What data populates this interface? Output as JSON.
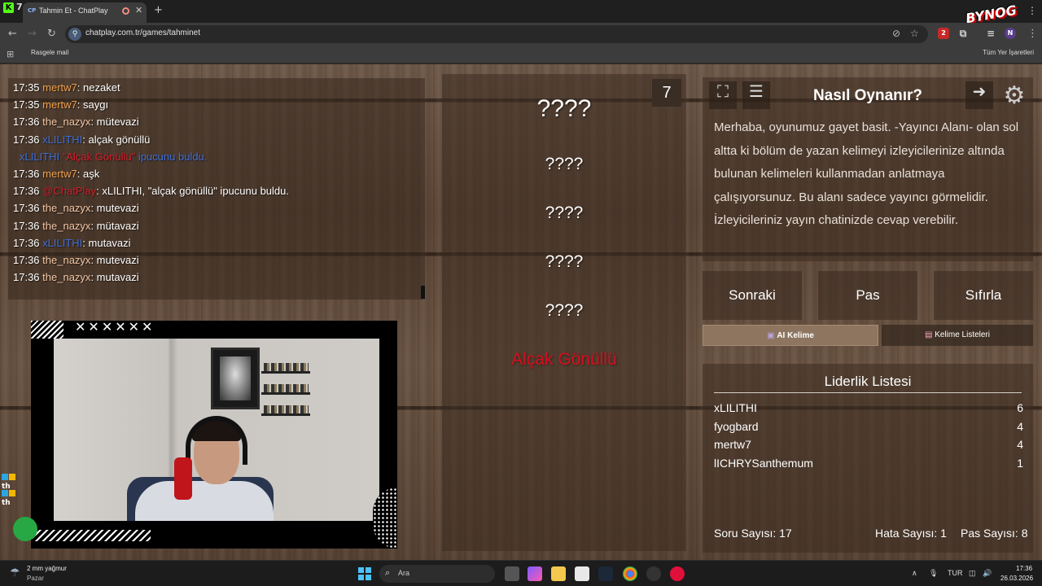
{
  "browser": {
    "k_badge": "K",
    "k_count": "7",
    "tab": {
      "favicon": "CP",
      "title": "Tahmin Et - ChatPlay"
    },
    "url": "chatplay.com.tr/games/tahminet",
    "bookmark": "Rasgele mail",
    "bookmarks_all": "Tüm Yer İşaretleri",
    "brand_logo": "BYNOG",
    "ext_badge": "2"
  },
  "chat": {
    "messages": [
      {
        "time": "17:35",
        "user": "mertw7",
        "color": "#f0a04b",
        "text": ": nezaket"
      },
      {
        "time": "17:35",
        "user": "mertw7",
        "color": "#f0a04b",
        "text": ": saygı"
      },
      {
        "time": "17:36",
        "user": "the_nazyx",
        "color": "#f3c6a5",
        "text": ": mütevazi"
      },
      {
        "time": "17:36",
        "user": "xLILITHI",
        "color": "#3f6fd8",
        "text": ": alçak gönüllü"
      },
      {
        "time": "",
        "user": "xLILITHI",
        "color": "#3f6fd8",
        "text": "",
        "quote": "\"Alçak Gönüllü\"",
        "quote_color": "#d11f2b",
        "suffix": " ipucunu buldu.",
        "suffix_color": "#3f6fd8"
      },
      {
        "time": "17:36",
        "user": "mertw7",
        "color": "#f0a04b",
        "text": ": aşk"
      },
      {
        "time": "17:36",
        "user": "@ChatPlay",
        "color": "#d11f2b",
        "text": ": xLILITHI, \"alçak gönüllü\" ipucunu buldu."
      },
      {
        "time": "17:36",
        "user": "the_nazyx",
        "color": "#f3c6a5",
        "text": ": mutevazi"
      },
      {
        "time": "17:36",
        "user": "the_nazyx",
        "color": "#f3c6a5",
        "text": ": mütavazi"
      },
      {
        "time": "17:36",
        "user": "xLILITHI",
        "color": "#3f6fd8",
        "text": ": mutavazi"
      },
      {
        "time": "17:36",
        "user": "the_nazyx",
        "color": "#f3c6a5",
        "text": ": mutevazi"
      },
      {
        "time": "17:36",
        "user": "the_nazyx",
        "color": "#f3c6a5",
        "text": ": mutavazi"
      }
    ]
  },
  "overlay": {
    "x_marks": "✕✕✕✕✕✕",
    "side_labels": [
      "th",
      "th"
    ]
  },
  "game": {
    "count": "7",
    "main_word": "????",
    "hints": [
      "????",
      "????",
      "????",
      "????"
    ],
    "found_hint": "Alçak Gönüllü",
    "found_color": "#d60f1d"
  },
  "how_to": {
    "title": "Nasıl Oynanır?",
    "text": "Merhaba, oyunumuz gayet basit. -Yayıncı Alanı- olan sol altta ki bölüm de yazan kelimeyi izleyicilerinize altında bulunan kelimeleri kullanmadan anlatmaya çalışıyorsunuz. Bu alanı sadece yayıncı görmelidir. İzleyicileriniz yayın chatinizde cevap verebilir."
  },
  "controls": {
    "next": "Sonraki",
    "pass": "Pas",
    "reset": "Sıfırla",
    "ai_tab": "AI Kelime",
    "lists_tab": "Kelime Listeleri"
  },
  "leaderboard": {
    "title": "Liderlik Listesi",
    "rows": [
      {
        "name": "xLILITHI",
        "score": "6"
      },
      {
        "name": "fyogbard",
        "score": "4"
      },
      {
        "name": "mertw7",
        "score": "4"
      },
      {
        "name": "lICHRYSanthemum",
        "score": "1"
      }
    ]
  },
  "stats": {
    "questions": "Soru Sayısı: 17",
    "errors": "Hata Sayısı: 1",
    "passes": "Pas Sayısı: 8"
  },
  "taskbar": {
    "weather_temp": "2 mm yağmur",
    "weather_day": "Pazar",
    "search_placeholder": "Ara",
    "lang": "TUR",
    "time": "17:36",
    "date": "26.03.2026"
  }
}
